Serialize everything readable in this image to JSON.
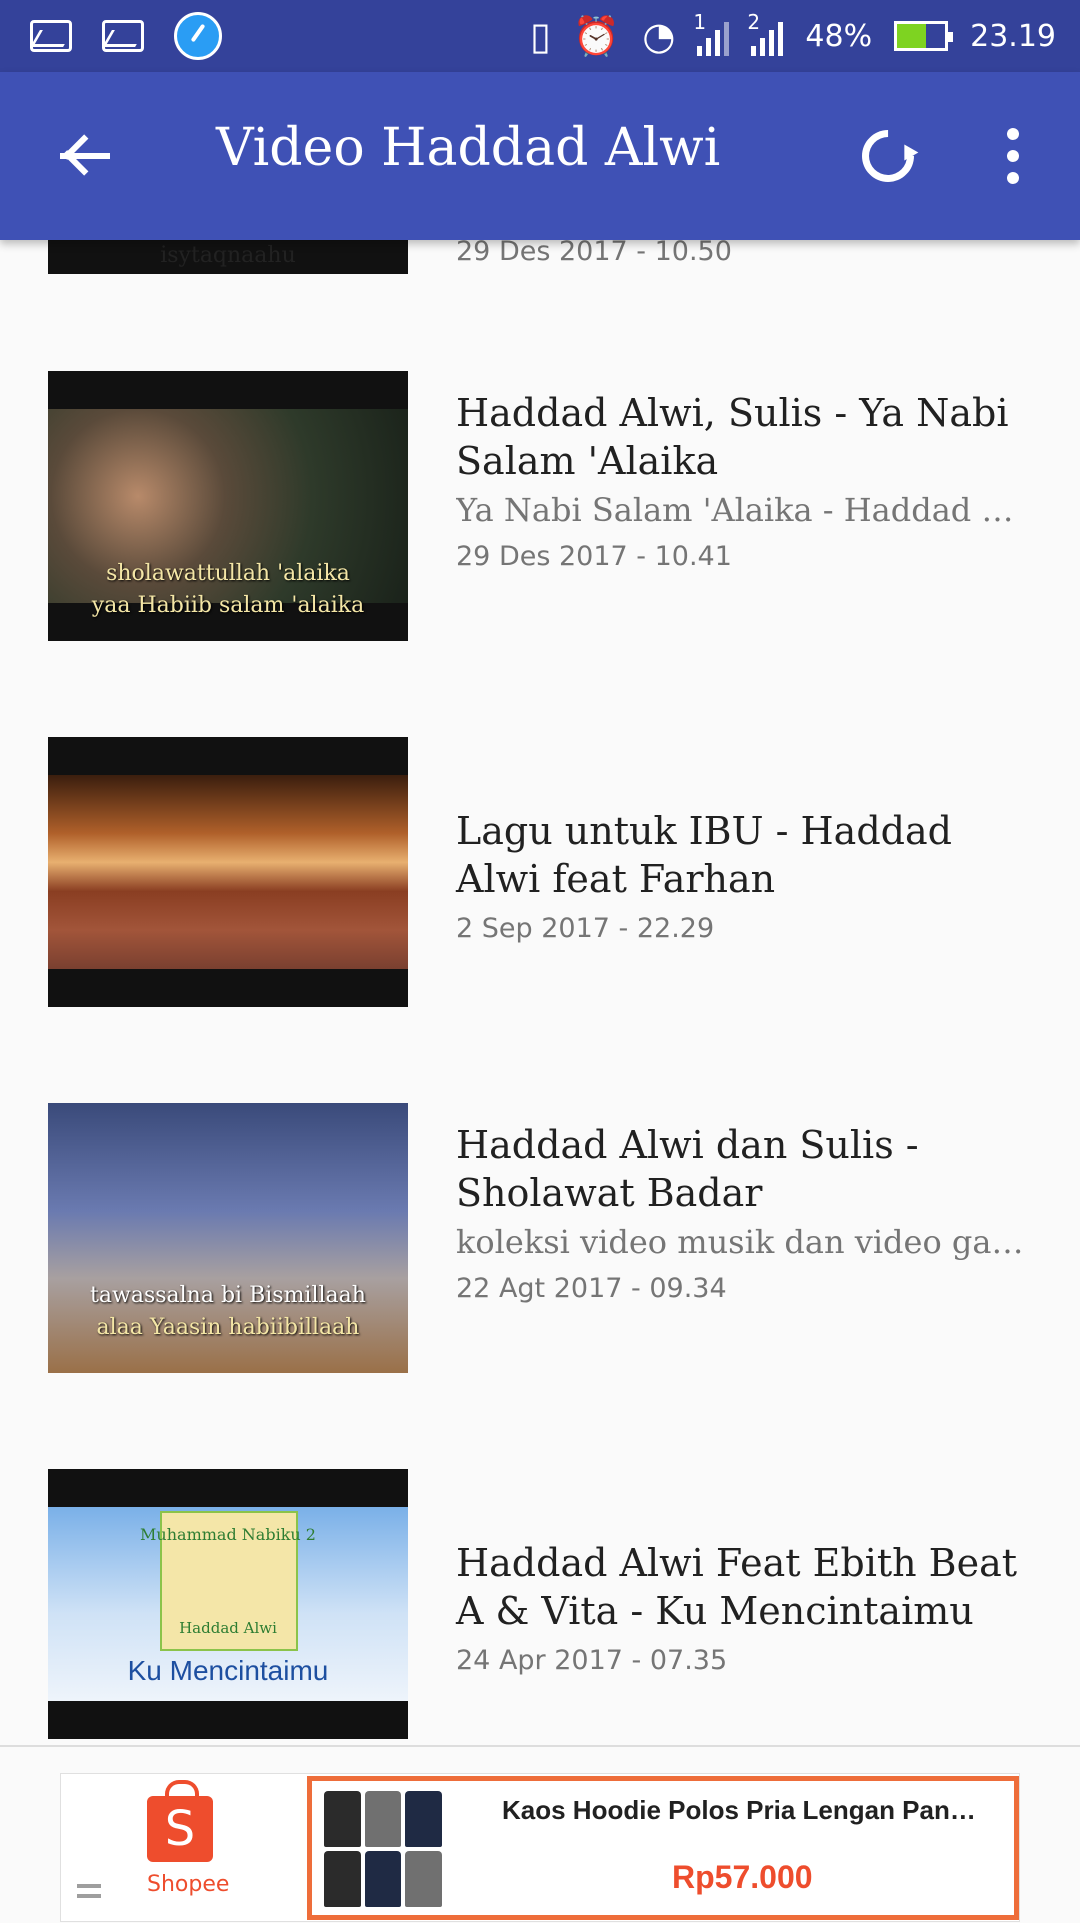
{
  "status_bar": {
    "battery": "48%",
    "time": "23.19",
    "sim1": "1",
    "sim2": "2",
    "icons": [
      "gallery-icon",
      "gallery-icon",
      "speed-booster-icon",
      "vibrate-icon",
      "alarm-icon",
      "wifi-icon",
      "signal-icon",
      "signal-icon",
      "battery-charging-icon"
    ]
  },
  "app_bar": {
    "title": "Video Haddad Alwi",
    "icons": [
      "back-arrow-icon",
      "refresh-icon",
      "more-vert-icon"
    ]
  },
  "videos": [
    {
      "title": "",
      "description": "",
      "date": "29 Des 2017 - 10.50",
      "caption": "isytaqnaahu"
    },
    {
      "title": "Haddad Alwi, Sulis - Ya Nabi Salam 'Alaika",
      "description": "Ya Nabi Salam 'Alaika - Haddad Alwi & Sulis © Emperor Edutainment",
      "date": "29 Des 2017 - 10.41",
      "caption1": "sholawattullah 'alaika",
      "caption2": "yaa Habiib salam 'alaika"
    },
    {
      "title": "Lagu untuk IBU - Haddad Alwi feat Farhan",
      "description": "",
      "date": "2 Sep 2017 - 22.29"
    },
    {
      "title": "Haddad Alwi dan Sulis - Sholawat Badar",
      "description": "koleksi video musik dan video gaming buatan saya ada di channel ini",
      "date": "22 Agt 2017 - 09.34",
      "caption1": "tawassalna bi Bismillaah",
      "caption2": "alaa Yaasin habiibillaah"
    },
    {
      "title": "Haddad Alwi Feat Ebith Beat A & Vita - Ku Mencintaimu",
      "description": "",
      "date": "24 Apr 2017 - 07.35",
      "caption1": "Muhammad Nabiku 2",
      "caption2": "Haddad Alwi",
      "caption3": "Ku Mencintaimu"
    }
  ],
  "ad": {
    "brand": "Shopee",
    "brand_letter": "S",
    "product_title": "Kaos Hoodie Polos Pria Lengan Panjang",
    "price": "Rp57.000",
    "accent": "#ee4d2d"
  },
  "colors": {
    "status_bar": "#34429a",
    "app_bar": "#3f51b5",
    "background": "#fafafa"
  }
}
